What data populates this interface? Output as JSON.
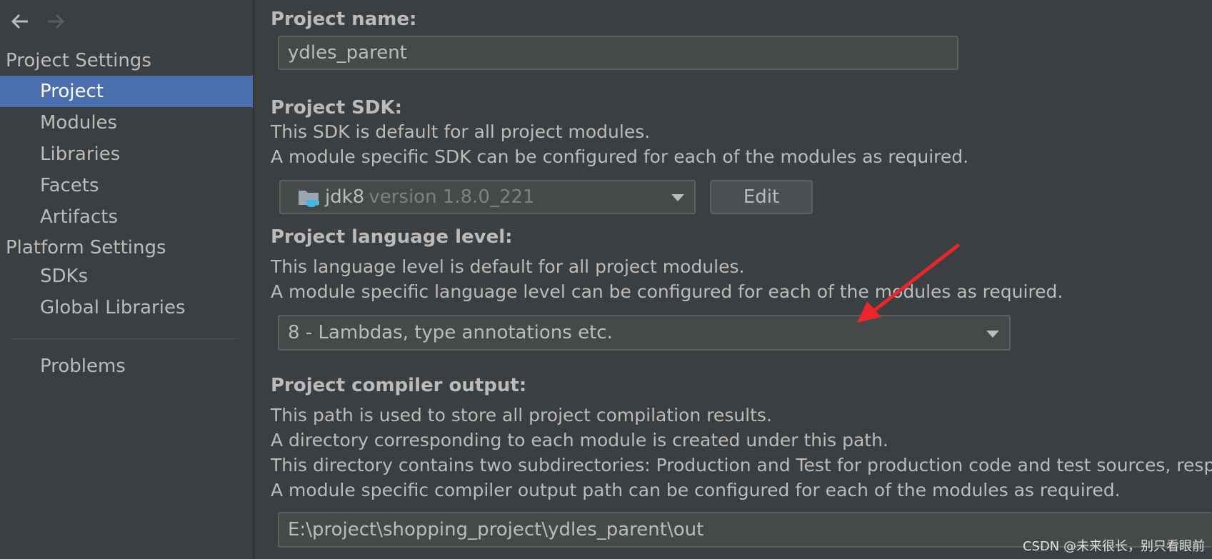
{
  "sidebar": {
    "project_settings_title": "Project Settings",
    "project_settings_items": [
      {
        "label": "Project"
      },
      {
        "label": "Modules"
      },
      {
        "label": "Libraries"
      },
      {
        "label": "Facets"
      },
      {
        "label": "Artifacts"
      }
    ],
    "platform_settings_title": "Platform Settings",
    "platform_settings_items": [
      {
        "label": "SDKs"
      },
      {
        "label": "Global Libraries"
      }
    ],
    "problems_label": "Problems"
  },
  "main": {
    "project_name": {
      "label": "Project name:",
      "value": "ydles_parent"
    },
    "project_sdk": {
      "label": "Project SDK:",
      "desc_1": "This SDK is default for all project modules.",
      "desc_2": "A module specific SDK can be configured for each of the modules as required.",
      "selected_name": "jdk8",
      "selected_version": "version 1.8.0_221",
      "edit_label": "Edit"
    },
    "language_level": {
      "label": "Project language level:",
      "desc_1": "This language level is default for all project modules.",
      "desc_2": "A module specific language level can be configured for each of the modules as required.",
      "selected": "8 - Lambdas, type annotations etc."
    },
    "compiler_output": {
      "label": "Project compiler output:",
      "desc_1": "This path is used to store all project compilation results.",
      "desc_2": "A directory corresponding to each module is created under this path.",
      "desc_3": "This directory contains two subdirectories: Production and Test for production code and test sources, respect",
      "desc_4": "A module specific compiler output path can be configured for each of the modules as required.",
      "path": "E:\\project\\shopping_project\\ydles_parent\\out"
    }
  },
  "watermark": "CSDN @未来很长，别只看眼前",
  "colors": {
    "background": "#3c3f41",
    "selected": "#4b6eaf",
    "field": "#45494a",
    "annotation_arrow": "#e8262b"
  }
}
